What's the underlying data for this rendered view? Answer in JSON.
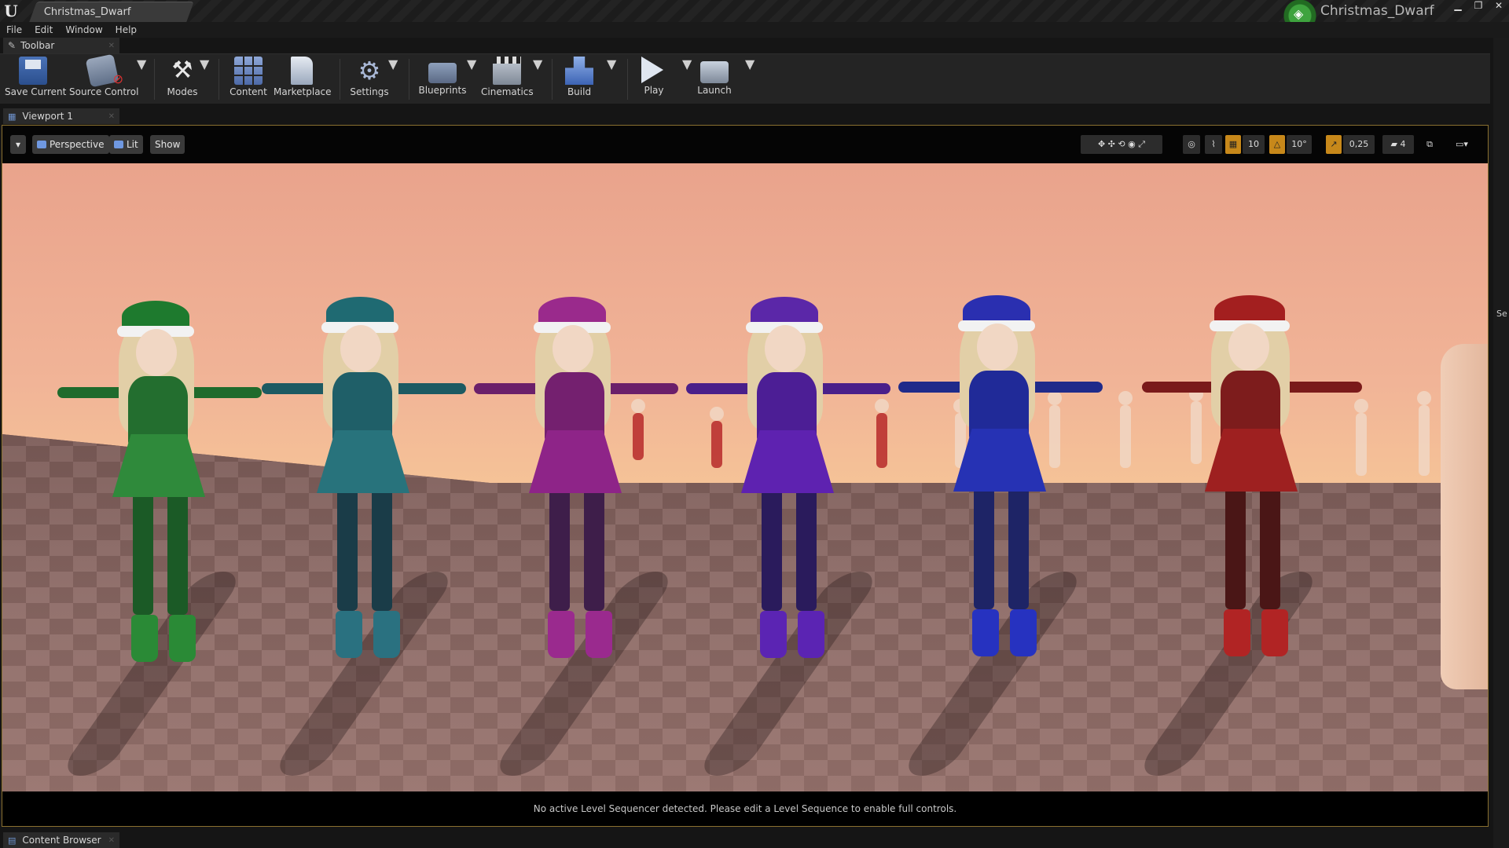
{
  "window": {
    "doc_tab": "Christmas_Dwarf",
    "project_name": "Christmas_Dwarf",
    "controls": [
      "▁",
      "❐",
      "✕"
    ]
  },
  "menu": [
    "File",
    "Edit",
    "Window",
    "Help"
  ],
  "toolbar_tab": "Toolbar",
  "toolbar": {
    "save_current": "Save Current",
    "source_control": "Source Control",
    "modes": "Modes",
    "content": "Content",
    "marketplace": "Marketplace",
    "settings": "Settings",
    "blueprints": "Blueprints",
    "cinematics": "Cinematics",
    "build": "Build",
    "play": "Play",
    "launch": "Launch"
  },
  "viewport": {
    "tab_label": "Viewport 1",
    "perspective": "Perspective",
    "lit": "Lit",
    "show": "Show",
    "grid_snap": "10",
    "rotation_snap": "10°",
    "scale_snap": "0,25",
    "camera_speed": "4",
    "status_message": "No active Level Sequencer detected. Please edit a Level Sequence to enable full controls."
  },
  "content_browser_tab": "Content Browser",
  "right_panel_label": "Se",
  "colors": {
    "accent_orange": "#c7881a",
    "accent_blue": "#2f4e82",
    "viewport_border": "#8a7030"
  }
}
